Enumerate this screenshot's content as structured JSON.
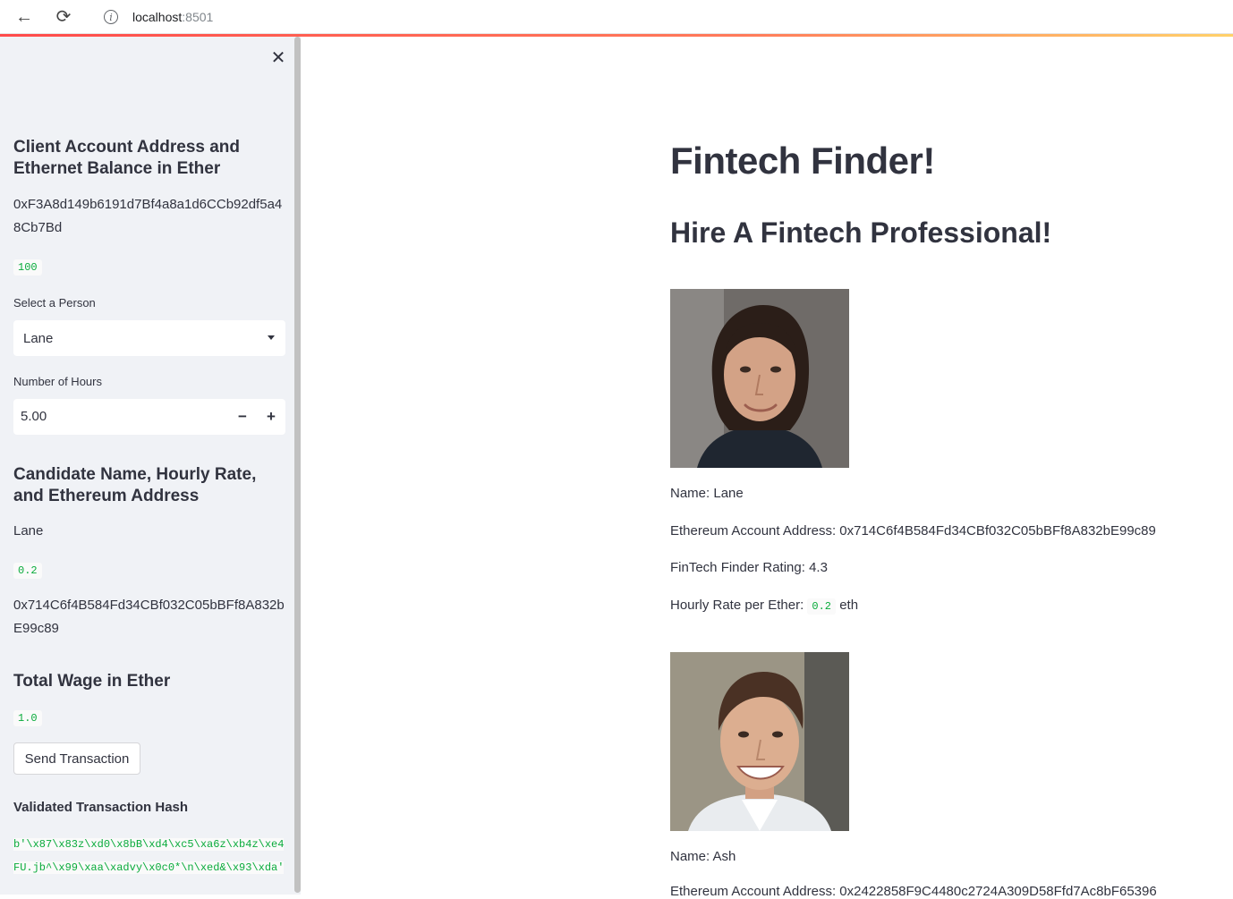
{
  "browser": {
    "url_host": "localhost",
    "url_port": ":8501"
  },
  "sidebar": {
    "account_heading": "Client Account Address and Ethernet Balance in Ether",
    "account_address": "0xF3A8d149b6191d7Bf4a8a1d6CCb92df5a48Cb7Bd",
    "balance": "100",
    "select_label": "Select a Person",
    "select_value": "Lane",
    "hours_label": "Number of Hours",
    "hours_value": "5.00",
    "candidate_heading": "Candidate Name, Hourly Rate, and Ethereum Address",
    "candidate_name": "Lane",
    "candidate_rate": "0.2",
    "candidate_address": "0x714C6f4B584Fd34CBf032C05bBFf8A832bE99c89",
    "wage_heading": "Total Wage in Ether",
    "wage_value": "1.0",
    "send_button": "Send Transaction",
    "hash_heading": "Validated Transaction Hash",
    "hash_value": "b'\\x87\\x83z\\xd0\\x8bB\\xd4\\xc5\\xa6z\\xb4z\\xe4FU.jb^\\x99\\xaa\\xadvy\\x0c0*\\n\\xed&\\x93\\xda'"
  },
  "main": {
    "title": "Fintech Finder!",
    "subtitle": "Hire A Fintech Professional!",
    "candidates": [
      {
        "name_line": "Name: Lane",
        "address_line": "Ethereum Account Address: 0x714C6f4B584Fd34CBf032C05bBFf8A832bE99c89",
        "rating_line": "FinTech Finder Rating: 4.3",
        "rate_prefix": "Hourly Rate per Ether:",
        "rate_value": "0.2",
        "rate_suffix": "eth"
      },
      {
        "name_line": "Name: Ash",
        "address_line": "Ethereum Account Address: 0x2422858F9C4480c2724A309D58Ffd7Ac8bF65396"
      }
    ]
  }
}
